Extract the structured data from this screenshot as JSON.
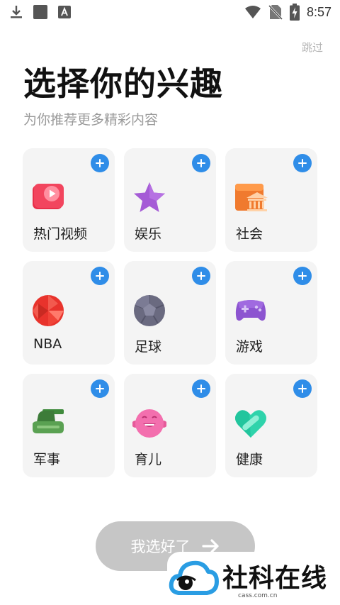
{
  "status_bar": {
    "time": "8:57",
    "icons": [
      "download-icon",
      "square-app-icon",
      "font-app-icon",
      "wifi-icon",
      "no-sim-icon",
      "battery-charging-icon"
    ]
  },
  "header": {
    "skip_label": "跳过",
    "title": "选择你的兴趣",
    "subtitle": "为你推荐更多精彩内容"
  },
  "interests": [
    {
      "label": "热门视频",
      "icon": "hot-video-icon"
    },
    {
      "label": "娱乐",
      "icon": "star-icon"
    },
    {
      "label": "社会",
      "icon": "bank-icon"
    },
    {
      "label": "NBA",
      "icon": "basketball-icon"
    },
    {
      "label": "足球",
      "icon": "soccer-ball-icon"
    },
    {
      "label": "游戏",
      "icon": "gamepad-icon"
    },
    {
      "label": "军事",
      "icon": "tank-icon"
    },
    {
      "label": "育儿",
      "icon": "baby-face-icon"
    },
    {
      "label": "健康",
      "icon": "heart-icon"
    }
  ],
  "footer": {
    "confirm_label": "我选好了"
  },
  "watermark": {
    "text": "社科在线",
    "sub": "cass.com.cn"
  },
  "colors": {
    "accent": "#2f8de8",
    "button_disabled": "#c6c6c6",
    "card_bg": "#f4f4f4"
  }
}
